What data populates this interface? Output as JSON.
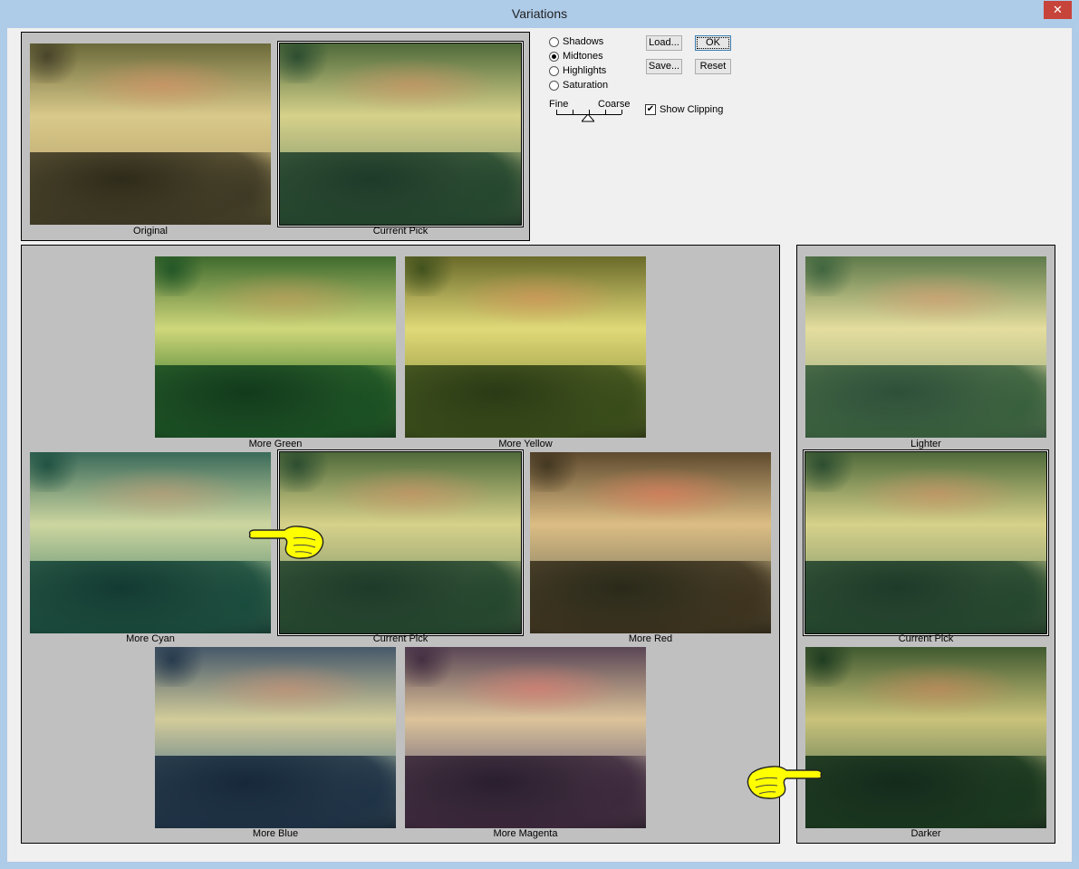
{
  "window": {
    "title": "Variations",
    "close": "✕"
  },
  "tone_options": [
    {
      "label": "Shadows",
      "selected": false
    },
    {
      "label": "Midtones",
      "selected": true
    },
    {
      "label": "Highlights",
      "selected": false
    },
    {
      "label": "Saturation",
      "selected": false
    }
  ],
  "slider": {
    "fine_label": "Fine",
    "coarse_label": "Coarse"
  },
  "buttons": {
    "load": "Load...",
    "ok": "OK",
    "save": "Save...",
    "reset": "Reset"
  },
  "show_clipping": {
    "label": "Show Clipping",
    "checked": true
  },
  "top_panel": {
    "original": "Original",
    "current_pick": "Current Pick"
  },
  "color_panel": {
    "more_green": "More Green",
    "more_yellow": "More Yellow",
    "more_cyan": "More Cyan",
    "current_pick": "Current Pick",
    "more_red": "More Red",
    "more_blue": "More Blue",
    "more_magenta": "More Magenta"
  },
  "brightness_panel": {
    "lighter": "Lighter",
    "current_pick": "Current Pick",
    "darker": "Darker"
  },
  "colors": {
    "title_bg": "#aecbe8",
    "close_bg": "#c7443a",
    "panel_bg": "#c0c0c0",
    "pointer": "#ffff00"
  }
}
